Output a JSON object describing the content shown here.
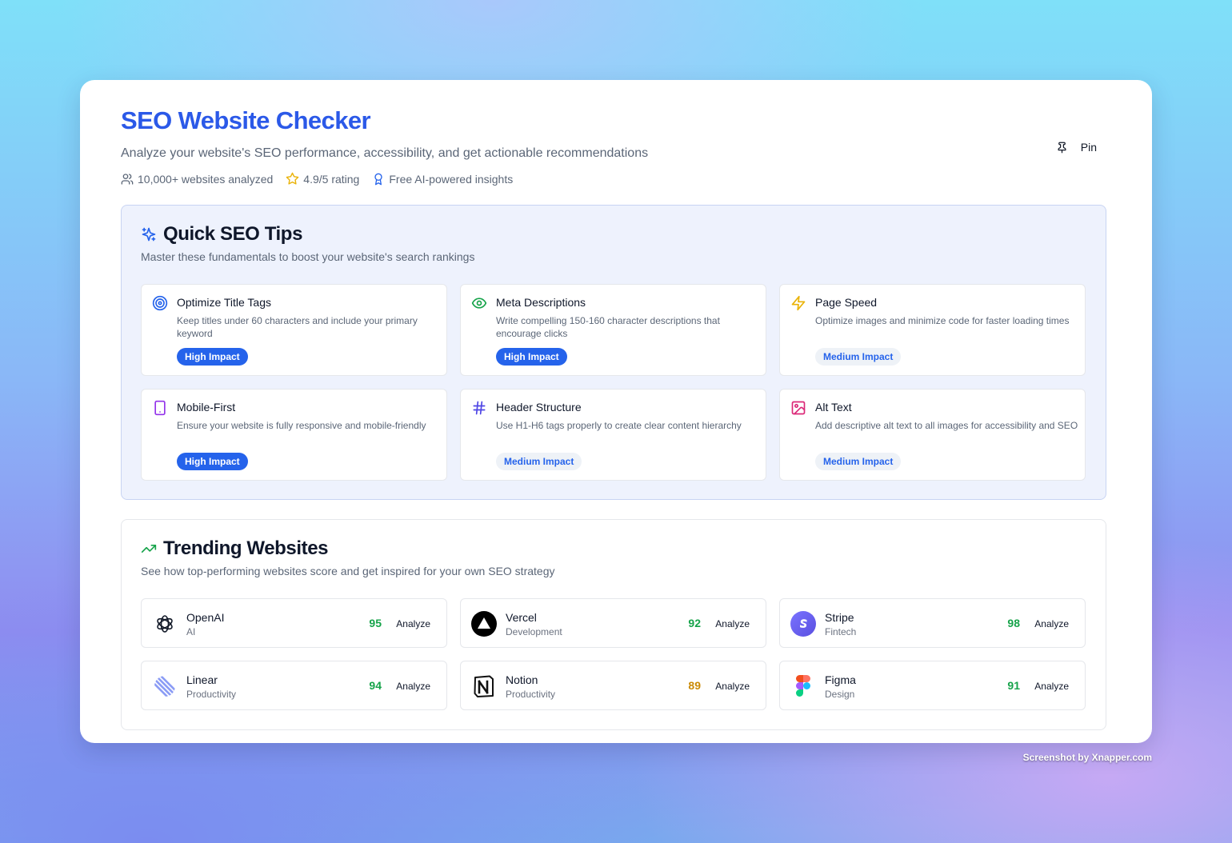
{
  "header": {
    "title": "SEO Website Checker",
    "subtitle": "Analyze your website's SEO performance, accessibility, and get actionable recommendations",
    "stats": [
      {
        "icon": "users-icon",
        "label": "10,000+ websites analyzed"
      },
      {
        "icon": "star-icon",
        "label": "4.9/5 rating"
      },
      {
        "icon": "award-icon",
        "label": "Free AI-powered insights"
      }
    ],
    "pin_label": "Pin"
  },
  "tips": {
    "title": "Quick SEO Tips",
    "subtitle": "Master these fundamentals to boost your website's search rankings",
    "items": [
      {
        "icon": "target-icon",
        "title": "Optimize Title Tags",
        "desc": "Keep titles under 60 characters and include your primary keyword",
        "impact": "High Impact"
      },
      {
        "icon": "eye-icon",
        "title": "Meta Descriptions",
        "desc": "Write compelling 150-160 character descriptions that encourage clicks",
        "impact": "High Impact"
      },
      {
        "icon": "zap-icon",
        "title": "Page Speed",
        "desc": "Optimize images and minimize code for faster loading times",
        "impact": "Medium Impact"
      },
      {
        "icon": "smartphone-icon",
        "title": "Mobile-First",
        "desc": "Ensure your website is fully responsive and mobile-friendly",
        "impact": "High Impact"
      },
      {
        "icon": "hash-icon",
        "title": "Header Structure",
        "desc": "Use H1-H6 tags properly to create clear content hierarchy",
        "impact": "Medium Impact"
      },
      {
        "icon": "image-icon",
        "title": "Alt Text",
        "desc": "Add descriptive alt text to all images for accessibility and SEO",
        "impact": "Medium Impact"
      }
    ]
  },
  "trending": {
    "title": "Trending Websites",
    "subtitle": "See how top-performing websites score and get inspired for your own SEO strategy",
    "analyze_label": "Analyze",
    "sites": [
      {
        "name": "OpenAI",
        "category": "AI",
        "score": "95",
        "logo": "openai-logo-icon"
      },
      {
        "name": "Vercel",
        "category": "Development",
        "score": "92",
        "logo": "vercel-logo-icon"
      },
      {
        "name": "Stripe",
        "category": "Fintech",
        "score": "98",
        "logo": "stripe-logo-icon"
      },
      {
        "name": "Linear",
        "category": "Productivity",
        "score": "94",
        "logo": "linear-logo-icon"
      },
      {
        "name": "Notion",
        "category": "Productivity",
        "score": "89",
        "logo": "notion-logo-icon"
      },
      {
        "name": "Figma",
        "category": "Design",
        "score": "91",
        "logo": "figma-logo-icon"
      }
    ]
  },
  "colors": {
    "accent": "#2b59e8",
    "high_badge": "#2563eb",
    "score_green": "#16a34a",
    "score_amber": "#ca8a04"
  },
  "watermark": "Screenshot by Xnapper.com"
}
